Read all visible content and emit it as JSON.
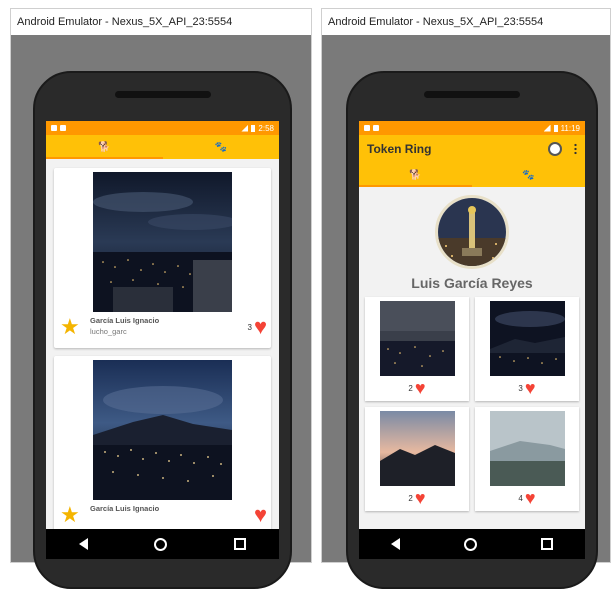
{
  "left_window": {
    "title": "Android Emulator - Nexus_5X_API_23:5554",
    "status_time": "2:58",
    "tabs": [
      {
        "icon": "dog-icon"
      },
      {
        "icon": "paw-icon"
      }
    ],
    "posts": [
      {
        "author": "García Luis Ignacio",
        "username": "lucho_garc",
        "likes": "3"
      },
      {
        "author": "García Luis Ignacio",
        "username": "",
        "likes": ""
      }
    ]
  },
  "right_window": {
    "title": "Android Emulator - Nexus_5X_API_23:5554",
    "status_time": "11:19",
    "toolbar_title": "Token Ring",
    "profile_name": "Luis García Reyes",
    "grid": [
      {
        "likes": "2"
      },
      {
        "likes": "3"
      },
      {
        "likes": "2"
      },
      {
        "likes": "4"
      }
    ]
  },
  "colors": {
    "status_bar": "#ff9800",
    "toolbar": "#ffc107",
    "heart": "#f44336",
    "star": "#f4b400"
  }
}
